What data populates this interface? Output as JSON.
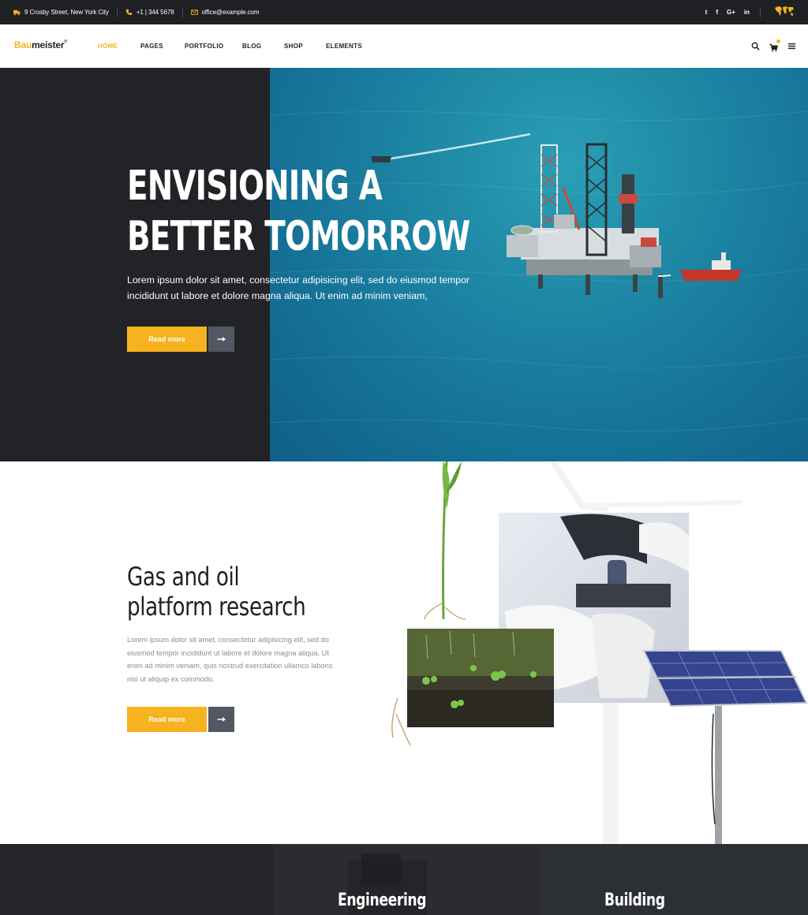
{
  "topbar": {
    "address": "9 Crosby Street, New York City",
    "phone": "+1 | 344 5678",
    "email": "office@example.com",
    "social": [
      "twitter-icon",
      "facebook-icon",
      "google-plus-icon",
      "linkedin-icon"
    ],
    "social_glyphs": [
      "t",
      "f",
      "G+",
      "in"
    ]
  },
  "nav": {
    "logo_accent": "Bau",
    "logo_rest": "meister",
    "logo_mark": "®",
    "items": [
      {
        "label": "HOME",
        "active": true
      },
      {
        "label": "PAGES",
        "active": false
      },
      {
        "label": "PORTFOLIO",
        "active": false
      },
      {
        "label": "BLOG",
        "active": false
      },
      {
        "label": "SHOP",
        "active": false
      },
      {
        "label": "ELEMENTS",
        "active": false
      }
    ],
    "icons": [
      "search-icon",
      "cart-icon",
      "menu-icon"
    ]
  },
  "hero": {
    "title_line1": "ENVISIONING A",
    "title_line2": "BETTER TOMORROW",
    "text_line1": "Lorem ipsum dolor sit amet, consectetur adipisicing elit, sed do eiusmod tempor",
    "text_line2": "incididunt ut labore et dolore magna aliqua. Ut enim ad minim veniam,",
    "button_label": "Read more"
  },
  "research": {
    "title_line1": "Gas and oil",
    "title_line2": "platform research",
    "text_line1": "Lorem ipsum dolor sit amet, consectetur adipisicing elit, sed do",
    "text_line2": "eiusmod tempor incididunt ut labore et dolore magna aliqua. Ut",
    "text_line3": "enim ad minim veniam, quis nostrud exercitation ullamco laboris",
    "text_line4": "nisi ut aliquip ex commodo.",
    "button_label": "Read more"
  },
  "services": {
    "items": [
      "Engineering",
      "Building"
    ]
  },
  "colors": {
    "accent": "#f7b21f",
    "dark": "#1e2023",
    "arrow_button": "#515863"
  }
}
